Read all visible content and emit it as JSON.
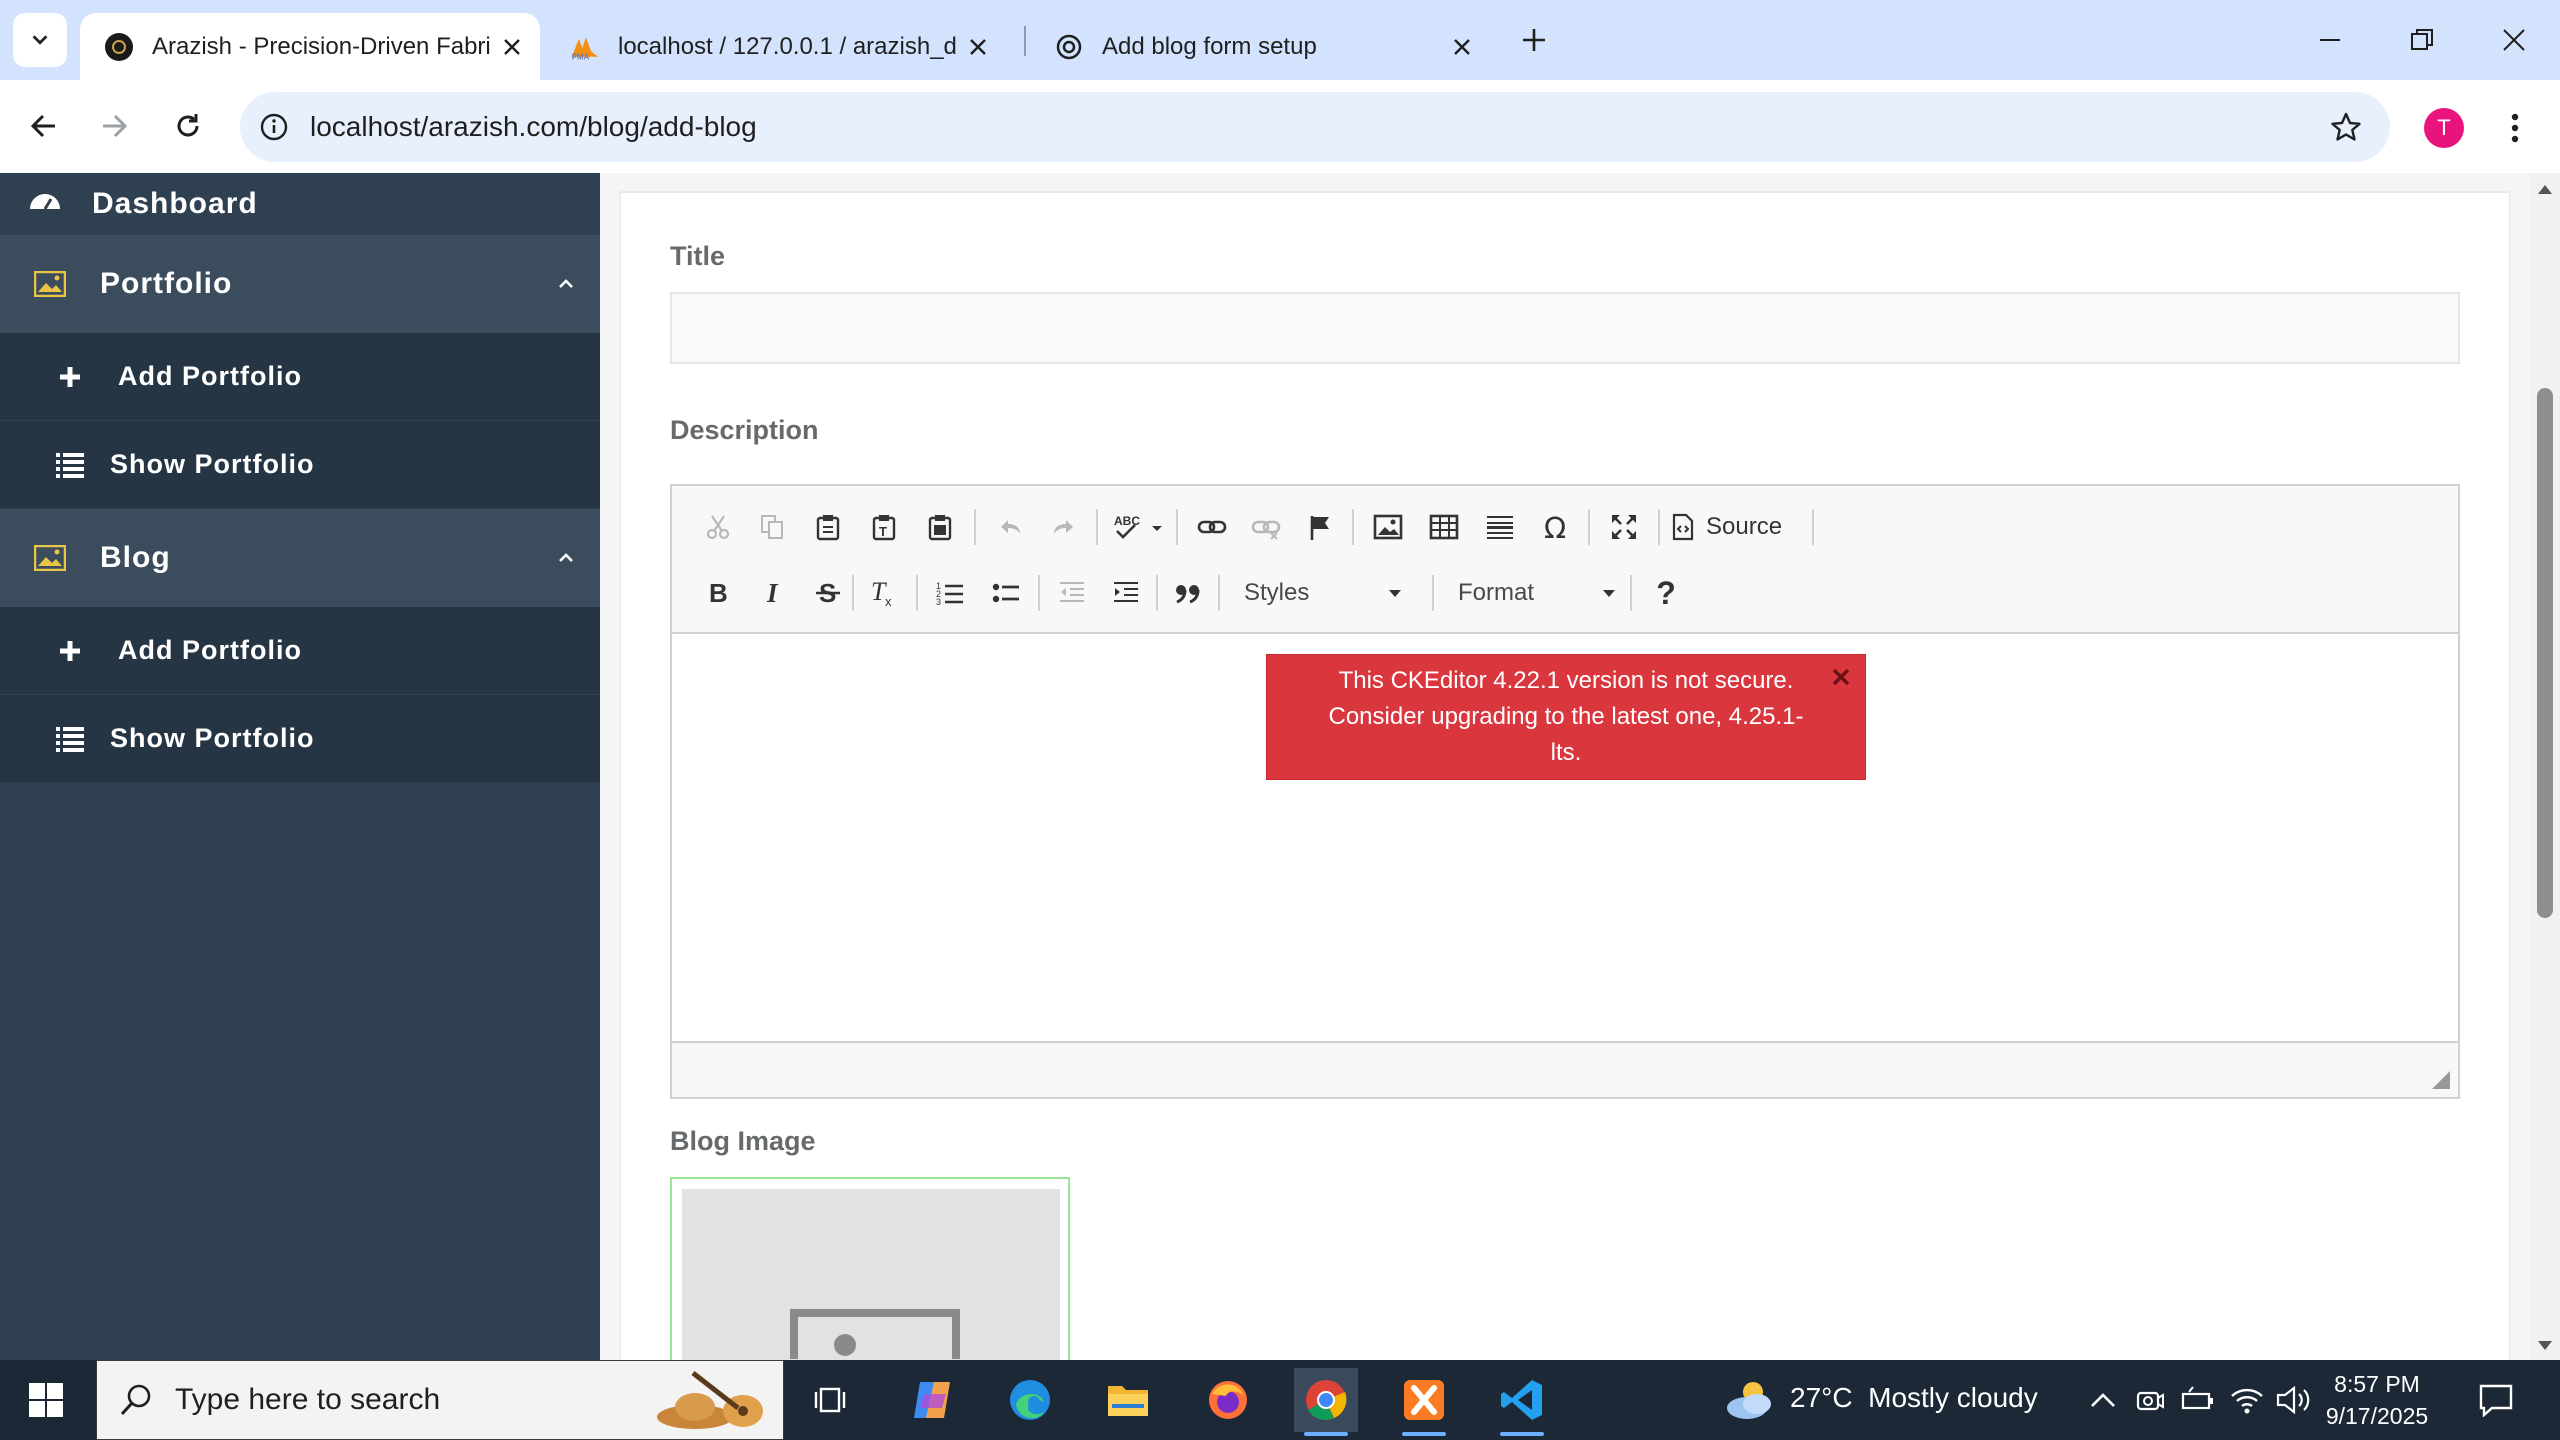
{
  "browser": {
    "tabs": [
      {
        "title": "Arazish - Precision-Driven Fabri",
        "active": true
      },
      {
        "title": "localhost / 127.0.0.1 / arazish_d",
        "active": false
      },
      {
        "title": "Add blog form setup",
        "active": false
      }
    ],
    "url": "localhost/arazish.com/blog/add-blog",
    "profile_initial": "T"
  },
  "sidebar": {
    "dashboard": "Dashboard",
    "sections": [
      {
        "label": "Portfolio",
        "items": [
          "Add Portfolio",
          "Show Portfolio"
        ]
      },
      {
        "label": "Blog",
        "items": [
          "Add Portfolio",
          "Show Portfolio"
        ]
      }
    ]
  },
  "form": {
    "title_label": "Title",
    "title_value": "",
    "description_label": "Description",
    "image_label": "Blog Image"
  },
  "editor": {
    "source_label": "Source",
    "styles_label": "Styles",
    "format_label": "Format",
    "help_label": "?",
    "notice_line1": "This CKEditor 4.22.1 version is not secure.",
    "notice_line2": "Consider upgrading to the latest one, 4.25.1-",
    "notice_line3": "lts."
  },
  "taskbar": {
    "search_placeholder": "Type here to search",
    "weather": "27°C  Mostly cloudy",
    "time": "8:57 PM",
    "date": "9/17/2025"
  },
  "colors": {
    "sidebar_bg": "#2f4050",
    "sidebar_active": "#3b4c5c",
    "notice_bg": "#d9363e",
    "accent": "#1a73e8"
  }
}
